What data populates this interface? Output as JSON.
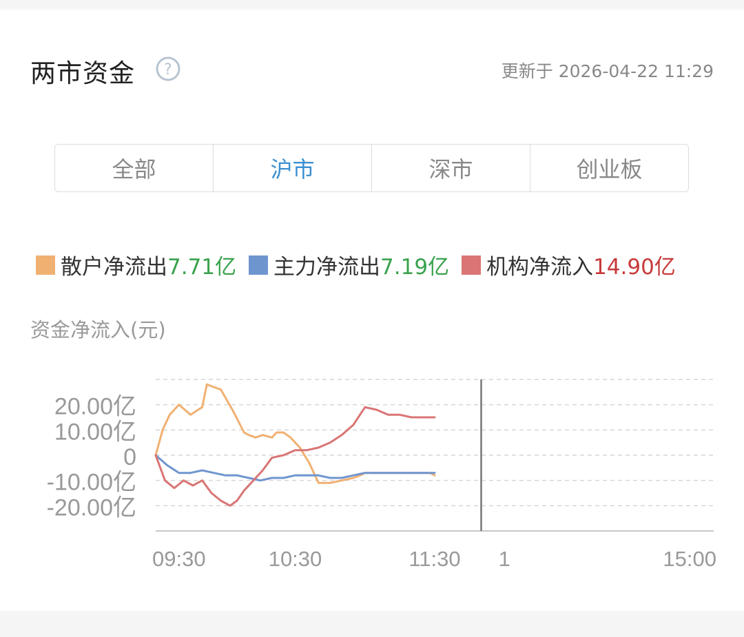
{
  "header": {
    "title": "两市资金",
    "update_text": "更新于 2026-04-22 11:29"
  },
  "icons": {
    "help": "question-circle-icon"
  },
  "tabs": [
    {
      "label": "全部",
      "active": false
    },
    {
      "label": "沪市",
      "active": true
    },
    {
      "label": "深市",
      "active": false
    },
    {
      "label": "创业板",
      "active": false
    }
  ],
  "legend": [
    {
      "name": "散户净流出",
      "value": "7.71亿",
      "color": "#f0b072",
      "value_color": "green"
    },
    {
      "name": "主力净流出",
      "value": "7.19亿",
      "color": "#6f95cf",
      "value_color": "green"
    },
    {
      "name": "机构净流入",
      "value": "14.90亿",
      "color": "#d97575",
      "value_color": "red"
    }
  ],
  "chart_data": {
    "type": "line",
    "ylabel": "资金净流入(元)",
    "y_ticks": [
      "20.00亿",
      "10.00亿",
      "0",
      "-10.00亿",
      "-20.00亿"
    ],
    "y_tick_values": [
      20,
      10,
      0,
      -10,
      -20
    ],
    "ylim": [
      -30,
      30
    ],
    "x_tick_labels": [
      "09:30",
      "10:30",
      "11:30",
      "1",
      "15:00"
    ],
    "x_tick_minutes": [
      0,
      60,
      120,
      150,
      240
    ],
    "xlim_minutes": [
      0,
      240
    ],
    "session_break_minute": 140,
    "grid": "dashed-horizontal",
    "series": [
      {
        "name": "散户净流出",
        "color": "#f0b072",
        "x": [
          0,
          3,
          6,
          10,
          15,
          20,
          22,
          25,
          28,
          33,
          38,
          40,
          43,
          46,
          50,
          52,
          55,
          58,
          62,
          66,
          70,
          75,
          80,
          85,
          88,
          90,
          94,
          96,
          98,
          101,
          104,
          108,
          110,
          114,
          118,
          120
        ],
        "y": [
          0,
          10,
          16,
          20,
          16,
          19,
          28,
          27,
          26,
          18,
          9,
          8,
          7,
          8,
          7,
          9,
          9,
          7,
          3,
          -3,
          -11,
          -11,
          -10,
          -9,
          -8,
          -7,
          -7,
          -7,
          -7,
          -7,
          -7,
          -7,
          -7,
          -7,
          -7,
          -8
        ]
      },
      {
        "name": "主力净流出",
        "color": "#6f95cf",
        "x": [
          0,
          5,
          10,
          15,
          20,
          25,
          30,
          35,
          40,
          45,
          50,
          55,
          60,
          65,
          70,
          75,
          80,
          85,
          90,
          95,
          100,
          105,
          110,
          115,
          120
        ],
        "y": [
          0,
          -4,
          -7,
          -7,
          -6,
          -7,
          -8,
          -8,
          -9,
          -10,
          -9,
          -9,
          -8,
          -8,
          -8,
          -9,
          -9,
          -8,
          -7,
          -7,
          -7,
          -7,
          -7,
          -7,
          -7
        ]
      },
      {
        "name": "机构净流入",
        "color": "#d97575",
        "x": [
          0,
          4,
          8,
          12,
          16,
          20,
          24,
          28,
          32,
          35,
          38,
          42,
          46,
          50,
          55,
          60,
          65,
          70,
          75,
          80,
          85,
          90,
          95,
          100,
          105,
          110,
          115,
          120
        ],
        "y": [
          0,
          -10,
          -13,
          -10,
          -12,
          -10,
          -15,
          -18,
          -20,
          -18,
          -14,
          -10,
          -6,
          -1,
          0,
          2,
          2,
          3,
          5,
          8,
          12,
          19,
          18,
          16,
          16,
          15,
          15,
          15
        ]
      }
    ]
  }
}
